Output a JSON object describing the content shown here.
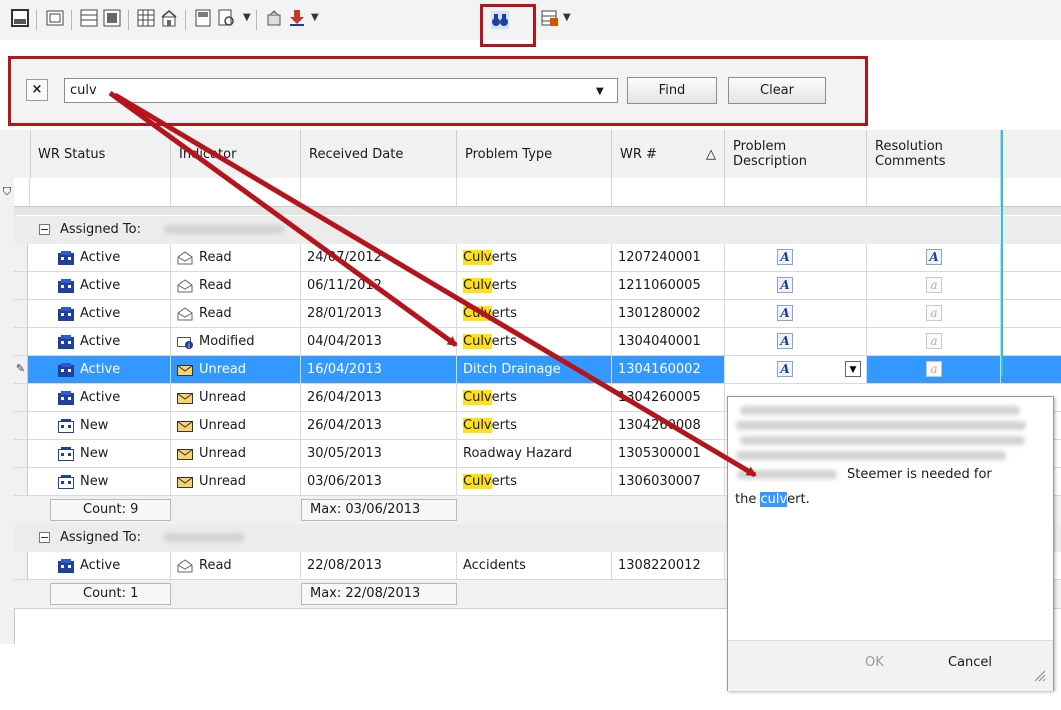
{
  "toolbar": {
    "icons": [
      "single-layout-icon",
      "form-view-icon",
      "split-left-icon",
      "split-right-icon",
      "group-icon",
      "organization-icon",
      "report-icon",
      "print-preview-icon",
      "assign-icon",
      "download-icon",
      "find-binoculars-icon",
      "column-chooser-icon"
    ]
  },
  "findbar": {
    "close_label": "×",
    "search_value": "culv",
    "find_label": "Find",
    "clear_label": "Clear"
  },
  "columns": [
    "WR Status",
    "Indicator",
    "Received Date",
    "Problem Type",
    "WR #",
    "Problem Description",
    "Resolution Comments"
  ],
  "sort_indicator": "△",
  "groups": [
    {
      "label": "Assigned To:",
      "rows": [
        {
          "status": "Active",
          "indicator": "Read",
          "date": "24/07/2012",
          "type_hl": "Culv",
          "type_rest": "erts",
          "wr": "1207240001",
          "desc_filled": true,
          "res_filled": true
        },
        {
          "status": "Active",
          "indicator": "Read",
          "date": "06/11/2012",
          "type_hl": "Culv",
          "type_rest": "erts",
          "wr": "1211060005",
          "desc_filled": true,
          "res_filled": false
        },
        {
          "status": "Active",
          "indicator": "Read",
          "date": "28/01/2013",
          "type_hl": "Culv",
          "type_rest": "erts",
          "wr": "1301280002",
          "desc_filled": true,
          "res_filled": false
        },
        {
          "status": "Active",
          "indicator": "Modified",
          "date": "04/04/2013",
          "type_hl": "Culv",
          "type_rest": "erts",
          "wr": "1304040001",
          "desc_filled": true,
          "res_filled": false
        },
        {
          "status": "Active",
          "indicator": "Unread",
          "date": "16/04/2013",
          "type_hl": "",
          "type_rest": "Ditch Drainage",
          "wr": "1304160002",
          "desc_filled": true,
          "res_filled": false,
          "selected": true
        },
        {
          "status": "Active",
          "indicator": "Unread",
          "date": "26/04/2013",
          "type_hl": "Culv",
          "type_rest": "erts",
          "wr": "1304260005"
        },
        {
          "status": "New",
          "indicator": "Unread",
          "date": "26/04/2013",
          "type_hl": "Culv",
          "type_rest": "erts",
          "wr": "1304260008"
        },
        {
          "status": "New",
          "indicator": "Unread",
          "date": "30/05/2013",
          "type_hl": "",
          "type_rest": "Roadway Hazard",
          "wr": "1305300001"
        },
        {
          "status": "New",
          "indicator": "Unread",
          "date": "03/06/2013",
          "type_hl": "Culv",
          "type_rest": "erts",
          "wr": "1306030007"
        }
      ],
      "count": "Count: 9",
      "max": "Max: 03/06/2013"
    },
    {
      "label": "Assigned To:",
      "rows": [
        {
          "status": "Active",
          "indicator": "Read",
          "date": "22/08/2013",
          "type_hl": "",
          "type_rest": "Accidents",
          "wr": "1308220012"
        }
      ],
      "count": "Count: 1",
      "max": "Max: 22/08/2013"
    }
  ],
  "popup": {
    "visible_text": "Steemer is needed for",
    "line2_prefix": "the ",
    "line2_highlight": "culv",
    "line2_suffix": "ert.",
    "ok_label": "OK",
    "cancel_label": "Cancel"
  },
  "colors": {
    "highlight": "#ffe11a",
    "selection": "#3399ff",
    "annotation": "#b5141d",
    "accent_line": "#25c8d8"
  }
}
